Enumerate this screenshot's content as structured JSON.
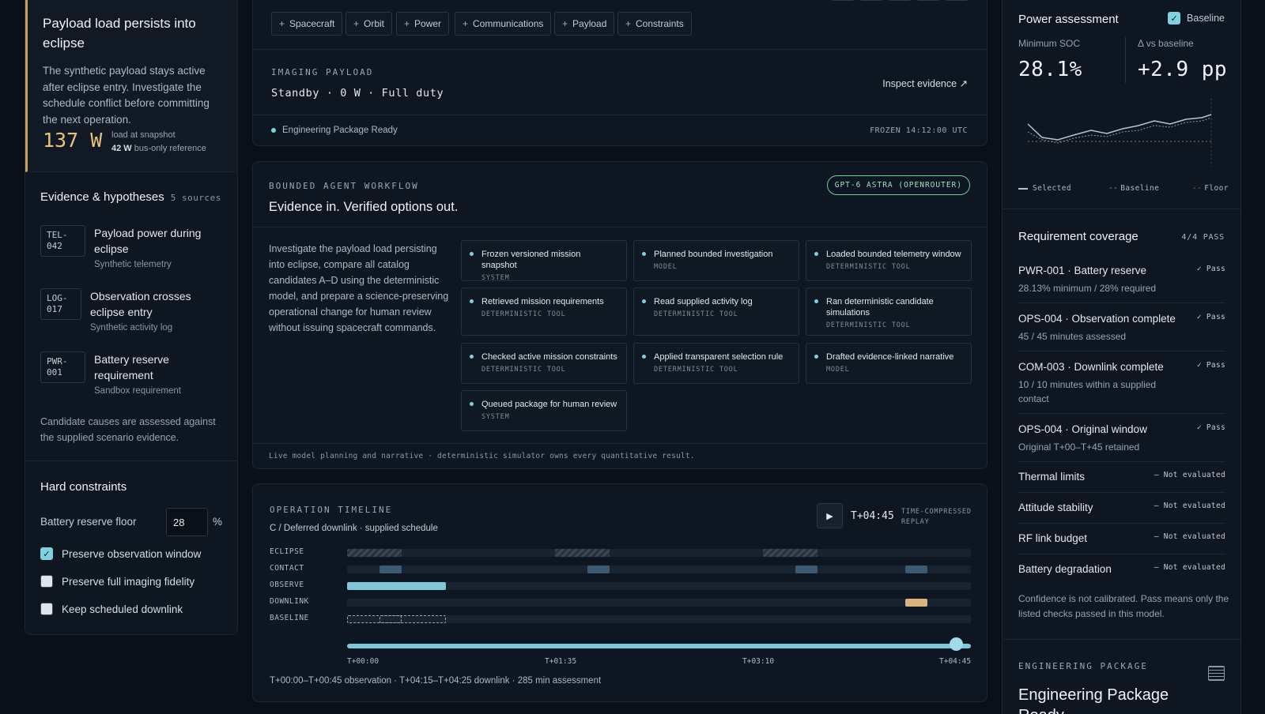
{
  "alert": {
    "title": "Payload load persists into eclipse",
    "body": "The synthetic payload stays active after eclipse entry. Investigate the schedule conflict before committing the next operation.",
    "metric": "137 W",
    "metric_label": "load at snapshot",
    "metric_ref_value": "42 W",
    "metric_ref_label": "bus-only reference"
  },
  "evidence": {
    "title": "Evidence & hypotheses",
    "count": "5 sources",
    "items": [
      {
        "tag_line1": "TEL-",
        "tag_line2": "042",
        "title": "Payload power during eclipse",
        "source": "Synthetic telemetry"
      },
      {
        "tag_line1": "LOG-",
        "tag_line2": "017",
        "title": "Observation crosses eclipse entry",
        "source": "Synthetic activity log"
      },
      {
        "tag_line1": "PWR-",
        "tag_line2": "001",
        "title": "Battery reserve requirement",
        "source": "Sandbox requirement"
      }
    ],
    "note": "Candidate causes are assessed against the supplied scenario evidence."
  },
  "constraints": {
    "title": "Hard constraints",
    "reserve_label": "Battery reserve floor",
    "reserve_value": "28",
    "reserve_unit": "%",
    "checks": [
      {
        "label": "Preserve observation window",
        "checked": true
      },
      {
        "label": "Preserve full imaging fidelity",
        "checked": false
      },
      {
        "label": "Keep scheduled downlink",
        "checked": false
      }
    ]
  },
  "chips": [
    "Spacecraft",
    "Orbit",
    "Power",
    "Communications",
    "Payload",
    "Constraints"
  ],
  "payload": {
    "eyebrow": "IMAGING PAYLOAD",
    "state": "Standby · 0 W · Full duty",
    "link": "Inspect evidence ↗",
    "status": "Engineering Package Ready",
    "frozen": "FROZEN 14:12:00 UTC"
  },
  "workflow": {
    "eyebrow": "BOUNDED AGENT WORKFLOW",
    "title": "Evidence in. Verified options out.",
    "model_pill": "GPT-6 ASTRA (OPENROUTER)",
    "description": "Investigate the payload load persisting into eclipse, compare all catalog candidates A–D using the deterministic model, and prepare a science-preserving operational change for human review without issuing spacecraft commands.",
    "steps": [
      {
        "title": "Frozen versioned mission snapshot",
        "kind": "SYSTEM"
      },
      {
        "title": "Planned bounded investigation",
        "kind": "MODEL"
      },
      {
        "title": "Loaded bounded telemetry window",
        "kind": "DETERMINISTIC TOOL"
      },
      {
        "title": "Retrieved mission requirements",
        "kind": "DETERMINISTIC TOOL"
      },
      {
        "title": "Read supplied activity log",
        "kind": "DETERMINISTIC TOOL"
      },
      {
        "title": "Ran deterministic candidate simulations",
        "kind": "DETERMINISTIC TOOL"
      },
      {
        "title": "Checked active mission constraints",
        "kind": "DETERMINISTIC TOOL"
      },
      {
        "title": "Applied transparent selection rule",
        "kind": "DETERMINISTIC TOOL"
      },
      {
        "title": "Drafted evidence-linked narrative",
        "kind": "MODEL"
      },
      {
        "title": "Queued package for human review",
        "kind": "SYSTEM"
      }
    ],
    "footer": "Live model planning and narrative · deterministic simulator owns every quantitative result."
  },
  "timeline": {
    "eyebrow": "OPERATION TIMELINE",
    "subtitle": "C / Deferred downlink · supplied schedule",
    "current_time": "T+04:45",
    "replay_line1": "TIME-COMPRESSED",
    "replay_line2": "REPLAY",
    "lanes": [
      "ECLIPSE",
      "CONTACT",
      "OBSERVE",
      "DOWNLINK",
      "BASELINE"
    ],
    "ticks": [
      "T+00:00",
      "T+01:35",
      "T+03:10",
      "T+04:45"
    ],
    "scrub_progress": 1.0,
    "summary": "T+00:00–T+00:45 observation · T+04:15–T+04:25 downlink · 285 min assessment"
  },
  "power": {
    "title": "Power assessment",
    "baseline_label": "Baseline",
    "baseline_checked": true,
    "min_soc_label": "Minimum SOC",
    "min_soc_value": "28.1%",
    "delta_label": "Δ vs baseline",
    "delta_value": "+2.9 pp",
    "legend": {
      "selected": "Selected",
      "baseline": "Baseline",
      "floor": "Floor"
    }
  },
  "requirements": {
    "title": "Requirement coverage",
    "count": "4/4 PASS",
    "items": [
      {
        "name": "PWR-001 · Battery reserve",
        "detail": "28.13% minimum / 28% required",
        "status": "✓ Pass"
      },
      {
        "name": "OPS-004 · Observation complete",
        "detail": "45 / 45 minutes assessed",
        "status": "✓ Pass"
      },
      {
        "name": "COM-003 · Downlink complete",
        "detail": "10 / 10 minutes within a supplied contact",
        "status": "✓ Pass"
      },
      {
        "name": "OPS-004 · Original window",
        "detail": "Original T+00–T+45 retained",
        "status": "✓ Pass"
      },
      {
        "name": "Thermal limits",
        "detail": "",
        "status": "— Not evaluated"
      },
      {
        "name": "Attitude stability",
        "detail": "",
        "status": "— Not evaluated"
      },
      {
        "name": "RF link budget",
        "detail": "",
        "status": "— Not evaluated"
      },
      {
        "name": "Battery degradation",
        "detail": "",
        "status": "— Not evaluated"
      }
    ],
    "confidence_note": "Confidence is not calibrated. Pass means only the listed checks passed in this model."
  },
  "engineering": {
    "eyebrow": "ENGINEERING PACKAGE",
    "title": "Engineering Package Ready"
  },
  "colors": {
    "accent": "#7fd0e0",
    "warning": "#c9a05a",
    "pass": "#6fcf97",
    "downlink": "#d7b480"
  }
}
